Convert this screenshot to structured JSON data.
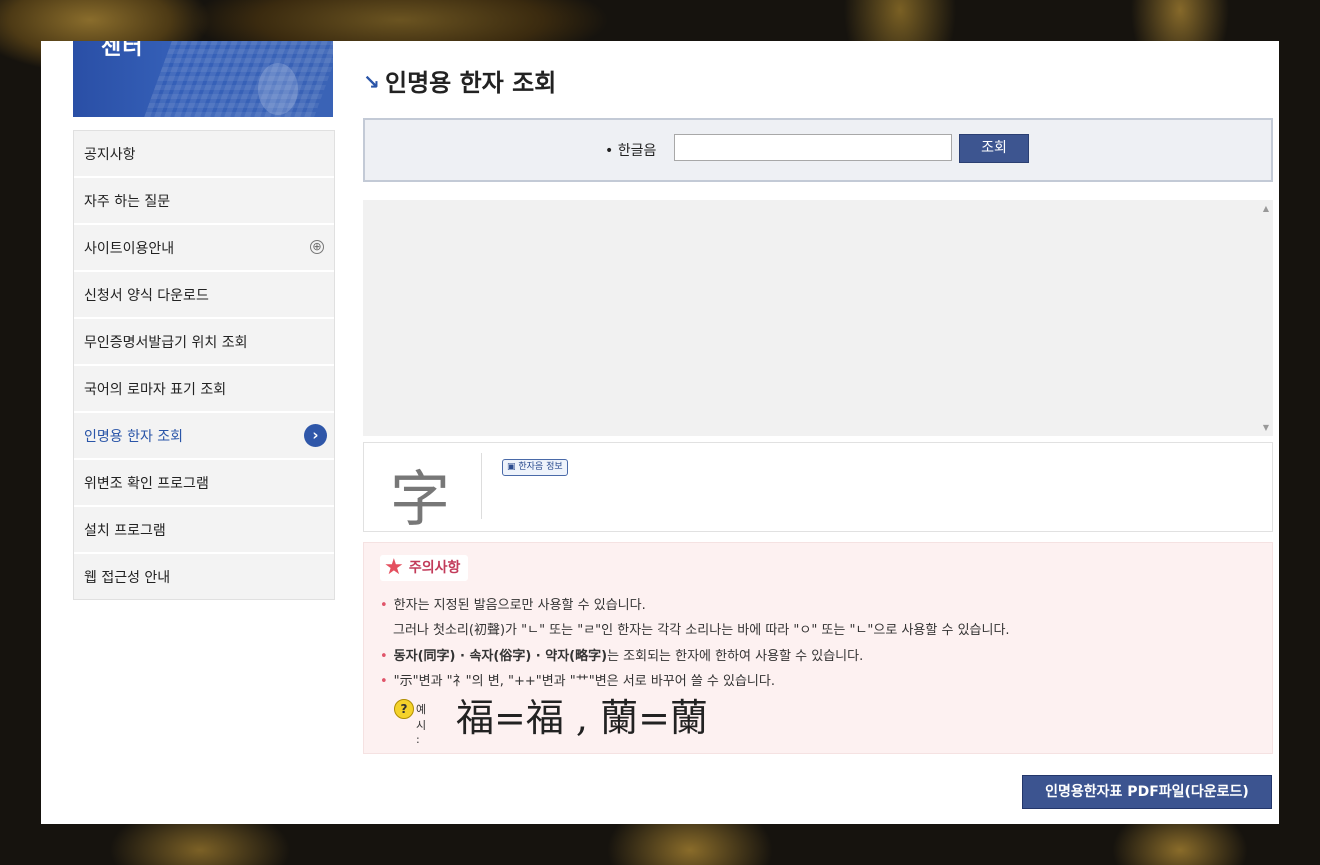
{
  "banner": {
    "title": "센터"
  },
  "nav": {
    "items": [
      {
        "label": "공지사항"
      },
      {
        "label": "자주 하는 질문"
      },
      {
        "label": "사이트이용안내"
      },
      {
        "label": "신청서 양식 다운로드"
      },
      {
        "label": "무인증명서발급기 위치 조회"
      },
      {
        "label": "국어의 로마자 표기 조회"
      },
      {
        "label": "인명용 한자 조회"
      },
      {
        "label": "위변조 확인 프로그램"
      },
      {
        "label": "설치 프로그램"
      },
      {
        "label": "웹 접근성 안내"
      }
    ],
    "plus_icon": "⊕",
    "arrow_icon": "›"
  },
  "page": {
    "title": "인명용 한자 조회",
    "title_mark": "↘"
  },
  "search": {
    "label": "• 한글음",
    "value": "",
    "button": "조회"
  },
  "results": {
    "scroll_up": "▲",
    "scroll_down": "▼"
  },
  "hanja": {
    "char": "字",
    "info_label": "한자음 정보"
  },
  "notice": {
    "title": "주의사항",
    "star": "★",
    "bullet": "•",
    "line1": "한자는 지정된 발음으로만 사용할 수 있습니다.",
    "line1b": "그러나 첫소리(初聲)가 \"ㄴ\" 또는 \"ㄹ\"인 한자는 각각 소리나는 바에 따라 \"ㅇ\" 또는 \"ㄴ\"으로 사용할 수 있습니다.",
    "line2_bold": "동자(同字) · 속자(俗字) · 약자(略字)",
    "line2_rest": "는 조회되는 한자에 한하여 사용할 수 있습니다.",
    "line3": "\"示\"변과 \"礻\"의 변, \"++\"변과 \"艹\"변은 서로 바꾸어 쓸 수 있습니다.",
    "example_q": "?",
    "example_label": "예시 :",
    "example_chars": "福=福 , 蘭=蘭"
  },
  "download": {
    "label": "인명용한자표 PDF파일(다운로드)"
  }
}
